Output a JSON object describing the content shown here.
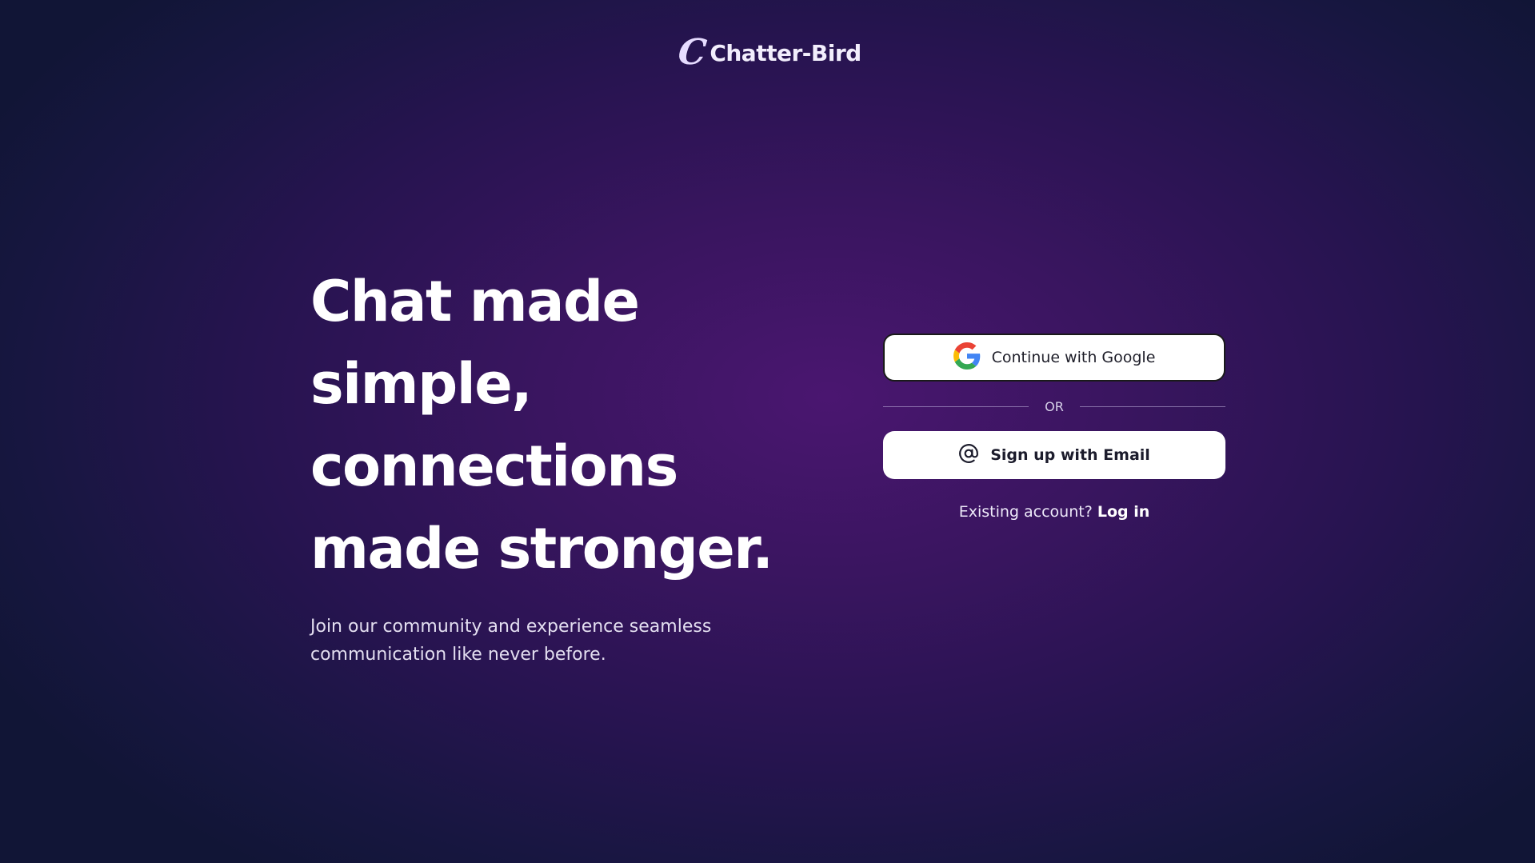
{
  "app": {
    "brand_mark": "C",
    "brand_name": "Chatter-Bird"
  },
  "hero": {
    "title": "Chat made simple, connections made stronger.",
    "subtitle": "Join our community and experience seamless communication like never before."
  },
  "auth": {
    "google_button_label": "Continue with Google",
    "divider_text": "OR",
    "email_button_label": "Sign up with Email",
    "existing_account_text": "Existing account?",
    "login_link_label": "Log in"
  },
  "icons": {
    "google": "google-g-logo",
    "email": "at-sign"
  },
  "colors": {
    "background_center": "#4a1670",
    "background_edge": "#111536",
    "button_bg": "#ffffff",
    "text": "#ffffff"
  }
}
